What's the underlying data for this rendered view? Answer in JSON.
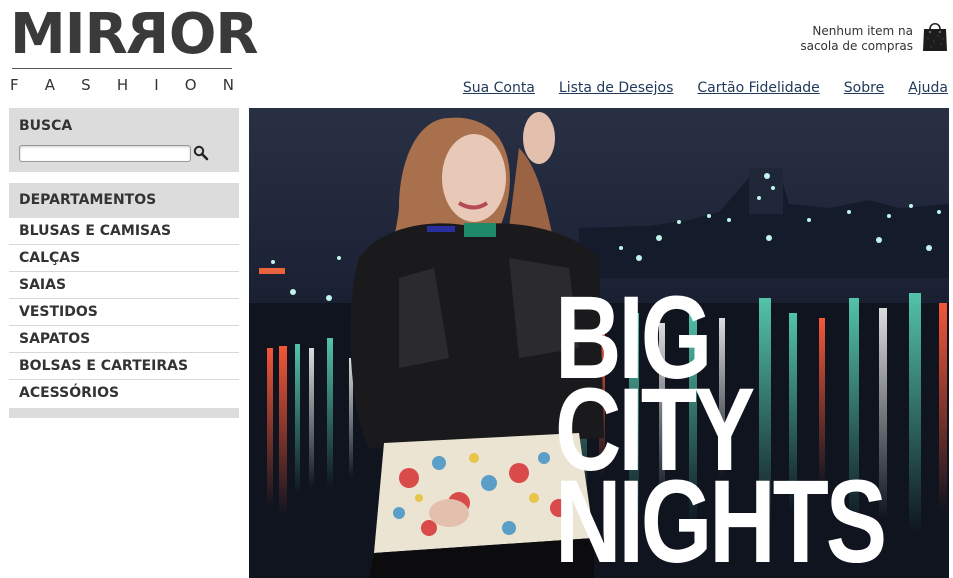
{
  "logo": {
    "main_prefix": "MIR",
    "main_reversed": "R",
    "main_suffix": "OR",
    "sub_letters": [
      "F",
      "A",
      "S",
      "H",
      "I",
      "O",
      "N"
    ]
  },
  "cart": {
    "line1": "Nenhum item na",
    "line2": "sacola de compras",
    "icon": "shopping-bag-icon"
  },
  "topnav": [
    {
      "label": "Sua Conta"
    },
    {
      "label": "Lista de Desejos"
    },
    {
      "label": "Cartão Fidelidade"
    },
    {
      "label": "Sobre"
    },
    {
      "label": "Ajuda"
    }
  ],
  "search": {
    "title": "BUSCA",
    "value": "",
    "placeholder": "",
    "icon": "magnifier-icon"
  },
  "departments": {
    "title": "DEPARTAMENTOS",
    "items": [
      {
        "label": "BLUSAS E CAMISAS"
      },
      {
        "label": "CALÇAS"
      },
      {
        "label": "SAIAS"
      },
      {
        "label": "VESTIDOS"
      },
      {
        "label": "SAPATOS"
      },
      {
        "label": "BOLSAS E CARTEIRAS"
      },
      {
        "label": "ACESSÓRIOS"
      }
    ]
  },
  "banner": {
    "lines": [
      "BIG",
      "CITY",
      "NIGHTS"
    ]
  },
  "colors": {
    "panel_bg": "#dcdcdc",
    "link": "#223a5c",
    "text": "#333333"
  }
}
